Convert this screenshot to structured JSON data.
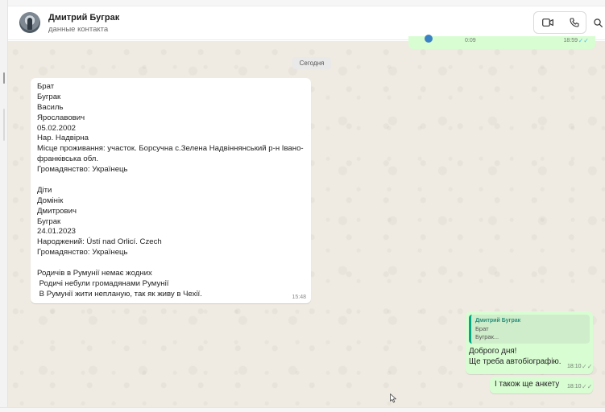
{
  "header": {
    "contact_name": "Дмитрий Буграк",
    "contact_subtitle": "данные контакта",
    "icons": [
      "video-call-icon",
      "phone-icon",
      "search-icon"
    ]
  },
  "voice_message": {
    "duration": "0:09",
    "time": "18:59",
    "status": "✓✓"
  },
  "date_separator": "Сегодня",
  "incoming_message": {
    "lines": [
      "Брат",
      "Буграк",
      "Василь",
      "Ярославович",
      "05.02.2002",
      "Нар. Надвірна",
      "Місце проживання: участок. Борсучна с.Зелена Надвіннянський р-н Івано-франківська обл.",
      "Громадянство: Українець",
      "",
      "Діти",
      "Домінік",
      "Дмитрович",
      "Буграк",
      "24.01.2023",
      "Народжений: Ústí nad Orlicí.  Czech",
      "Громадянство: Українець",
      "",
      "Родичів в Румунії немає жодних",
      " Родичі небули громадянами Румунії",
      " В Румунії жити непланую, так як живу в Чехії."
    ],
    "time": "15:48"
  },
  "outgoing_messages": [
    {
      "quote": {
        "author": "Дмитрий Буграк",
        "lines": [
          "Брат",
          "Буграк..."
        ]
      },
      "lines": [
        "Доброго дня!",
        "Ще треба автобіографію."
      ],
      "time": "18:10",
      "status": "✓✓"
    },
    {
      "lines": [
        "І також ще анкету"
      ],
      "time": "18:10",
      "status": "✓✓"
    }
  ],
  "colors": {
    "chat_background": "#efeae2",
    "outgoing_bubble": "#d9fdd3",
    "incoming_bubble": "#ffffff",
    "quote_accent": "#06a884",
    "read_check": "#53bdeb"
  }
}
